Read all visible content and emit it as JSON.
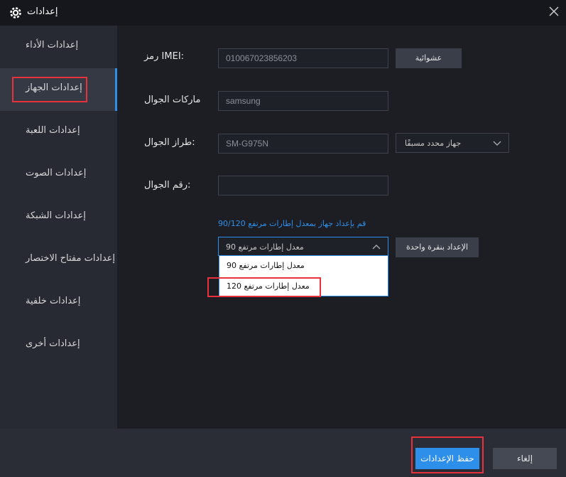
{
  "window": {
    "title": "إعدادات",
    "icon": "gear-icon",
    "close_icon": "close-icon"
  },
  "sidebar": {
    "items": [
      {
        "label": "إعدادات الأداء",
        "active": false
      },
      {
        "label": "إعدادات الجهاز",
        "active": true
      },
      {
        "label": "إعدادات اللعبة",
        "active": false
      },
      {
        "label": "إعدادات الصوت",
        "active": false
      },
      {
        "label": "إعدادات الشبكة",
        "active": false
      },
      {
        "label": "إعدادات مفتاح الاختصار",
        "active": false
      },
      {
        "label": "إعدادات خلفية",
        "active": false
      },
      {
        "label": "إعدادات أخرى",
        "active": false
      }
    ]
  },
  "device": {
    "imei_label": "رمز IMEI:",
    "imei_value": "010067023856203",
    "random_button": "عشوائية",
    "brand_label": "ماركات الجوال",
    "brand_value": "samsung",
    "model_label": "طراز الجوال:",
    "model_value": "SM-G975N",
    "preset_select": "جهاز محدد مسبقًا",
    "phone_label": "رقم الجوال:",
    "phone_value": "",
    "fps_hint": "قم بإعداد جهاز بمعدل إطارات مرتفع 90/120",
    "fps_selected": "معدل إطارات مرتفع 90",
    "fps_options": [
      "معدل إطارات مرتفع 90",
      "معدل إطارات مرتفع 120"
    ],
    "one_click_button": "الإعداد بنقرة واحدة"
  },
  "footer": {
    "save_label": "حفظ الإعدادات",
    "cancel_label": "إلغاء"
  },
  "colors": {
    "accent": "#2e8fea",
    "highlight": "#e8313b",
    "background": "#1c1e24",
    "sidebar": "#272a32"
  }
}
